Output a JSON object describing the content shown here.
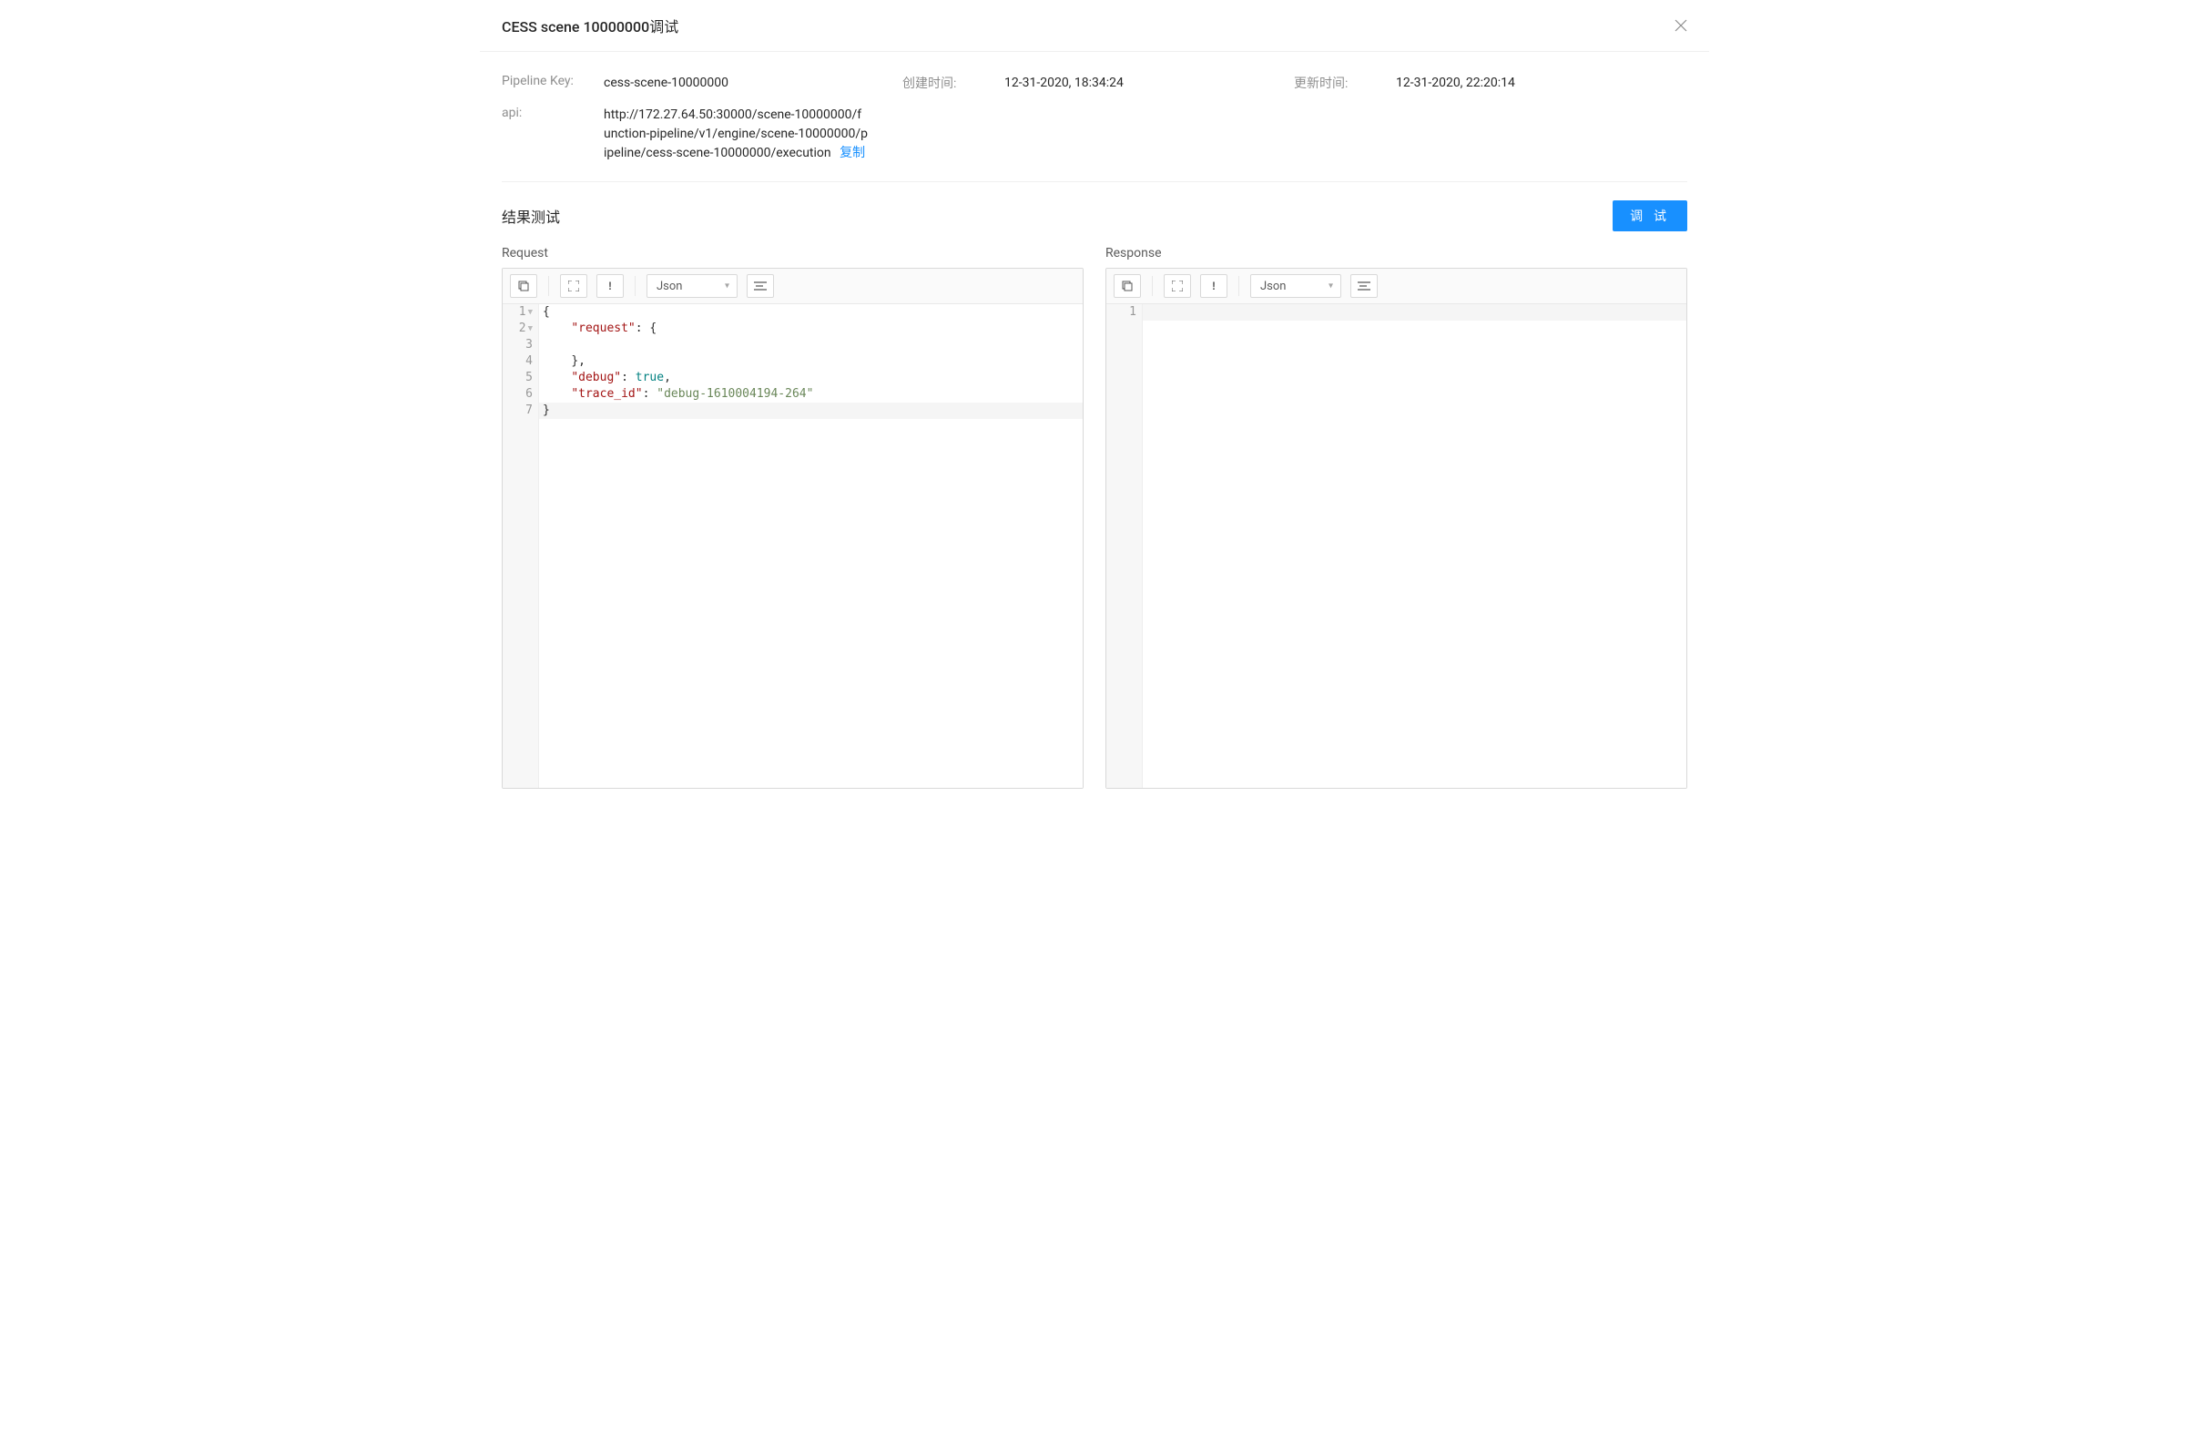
{
  "modal": {
    "title": "CESS scene 10000000调试"
  },
  "info": {
    "pipelineKeyLabel": "Pipeline Key:",
    "pipelineKeyValue": "cess-scene-10000000",
    "createdLabel": "创建时间:",
    "createdValue": "12-31-2020, 18:34:24",
    "updatedLabel": "更新时间:",
    "updatedValue": "12-31-2020, 22:20:14",
    "apiLabel": "api:",
    "apiValue": "http://172.27.64.50:30000/scene-10000000/function-pipeline/v1/engine/scene-10000000/pipeline/cess-scene-10000000/execution",
    "copyLabel": "复制"
  },
  "section": {
    "title": "结果测试",
    "debugButton": "调 试",
    "requestLabel": "Request",
    "responseLabel": "Response"
  },
  "toolbar": {
    "formatSelected": "Json"
  },
  "requestCode": {
    "lines": [
      {
        "n": 1,
        "fold": true,
        "tokens": [
          {
            "t": "punc",
            "v": "{"
          }
        ]
      },
      {
        "n": 2,
        "fold": true,
        "tokens": [
          {
            "t": "ws",
            "v": "    "
          },
          {
            "t": "key",
            "v": "\"request\""
          },
          {
            "t": "colon",
            "v": ": "
          },
          {
            "t": "punc",
            "v": "{"
          }
        ]
      },
      {
        "n": 3,
        "tokens": [
          {
            "t": "ws",
            "v": "        "
          }
        ]
      },
      {
        "n": 4,
        "tokens": [
          {
            "t": "ws",
            "v": "    "
          },
          {
            "t": "punc",
            "v": "},"
          }
        ]
      },
      {
        "n": 5,
        "tokens": [
          {
            "t": "ws",
            "v": "    "
          },
          {
            "t": "key",
            "v": "\"debug\""
          },
          {
            "t": "colon",
            "v": ": "
          },
          {
            "t": "bool",
            "v": "true"
          },
          {
            "t": "punc",
            "v": ","
          }
        ]
      },
      {
        "n": 6,
        "tokens": [
          {
            "t": "ws",
            "v": "    "
          },
          {
            "t": "key",
            "v": "\"trace_id\""
          },
          {
            "t": "colon",
            "v": ": "
          },
          {
            "t": "str",
            "v": "\"debug-1610004194-264\""
          }
        ]
      },
      {
        "n": 7,
        "hl": true,
        "tokens": [
          {
            "t": "punc",
            "v": "}"
          }
        ]
      }
    ]
  },
  "responseCode": {
    "lines": [
      {
        "n": 1,
        "hl": true,
        "tokens": []
      }
    ]
  }
}
